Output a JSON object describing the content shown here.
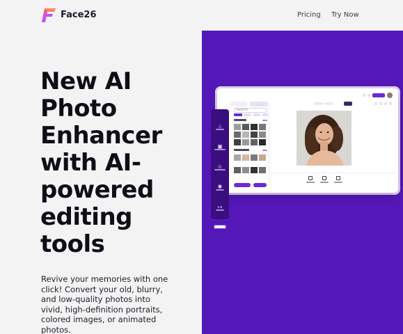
{
  "header": {
    "brand": "Face26",
    "nav": [
      {
        "label": "Pricing"
      },
      {
        "label": "Try Now"
      }
    ]
  },
  "hero": {
    "headline_lines": [
      "New AI",
      "Photo",
      "Enhancer",
      "with AI-",
      "powered",
      "editing",
      "tools"
    ],
    "description_lines": [
      "Revive your memories with one",
      "click! Convert your old, blurry,",
      "and low-quality photos into",
      "vivid, high-definition portraits,",
      "colored images, or animated",
      "photos."
    ]
  },
  "mock_app": {
    "search_placeholder": "Search"
  },
  "colors": {
    "page_bg": "#f3f3f4",
    "panel_purple": "#5518b8",
    "rail_purple": "#3a0e7e",
    "accent": "#6b2ad6",
    "headline": "#0e0e16"
  }
}
